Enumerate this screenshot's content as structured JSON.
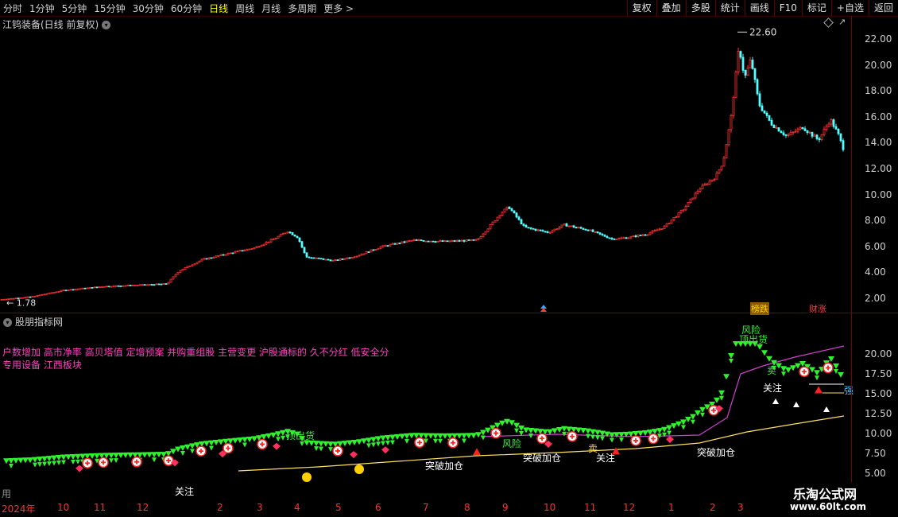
{
  "toolbar": {
    "periods": [
      "分时",
      "1分钟",
      "5分钟",
      "15分钟",
      "30分钟",
      "60分钟",
      "日线",
      "周线",
      "月线",
      "多周期",
      "更多 >"
    ],
    "active_period": "日线",
    "buttons": [
      "复权",
      "叠加",
      "多股",
      "统计",
      "画线",
      "F10",
      "标记",
      "+自选",
      "返回"
    ]
  },
  "main_chart": {
    "title": "江钨装备(日线 前复权)",
    "high_label": "22.60",
    "low_label": "1.78",
    "price_axis": [
      "22.00",
      "20.00",
      "18.00",
      "16.00",
      "14.00",
      "12.00",
      "10.00",
      "8.00",
      "6.00",
      "4.00",
      "2.00"
    ],
    "badge_1": "榜跌",
    "badge_2": "财涨",
    "colors": {
      "up": "#ff3232",
      "down": "#54ffff",
      "badge_bg": "#8b5a00"
    }
  },
  "indicator": {
    "title": "股朋指标网",
    "f10_line1": "户数增加 高市净率 高贝塔值 定增预案 并购重组股 主营变更 沪股通标的 久不分红 低安全分",
    "f10_line2": "专用设备 江西板块",
    "value_axis": [
      "20.00",
      "17.50",
      "15.00",
      "12.50",
      "10.00",
      "7.50",
      "5.00"
    ],
    "labels": {
      "breakout_add": "突破加仓",
      "top_sell": "顶出货",
      "risk": "风险",
      "attention": "关注",
      "sell": "卖",
      "strong": "强",
      "use": "用"
    }
  },
  "date_axis": [
    "2024年",
    "10",
    "11",
    "12",
    "2",
    "3",
    "4",
    "5",
    "6",
    "7",
    "8",
    "9",
    "10",
    "11",
    "12",
    "1",
    "2",
    "3"
  ],
  "watermark": {
    "name": "乐淘公式网",
    "url": "www.60lt.com"
  }
}
